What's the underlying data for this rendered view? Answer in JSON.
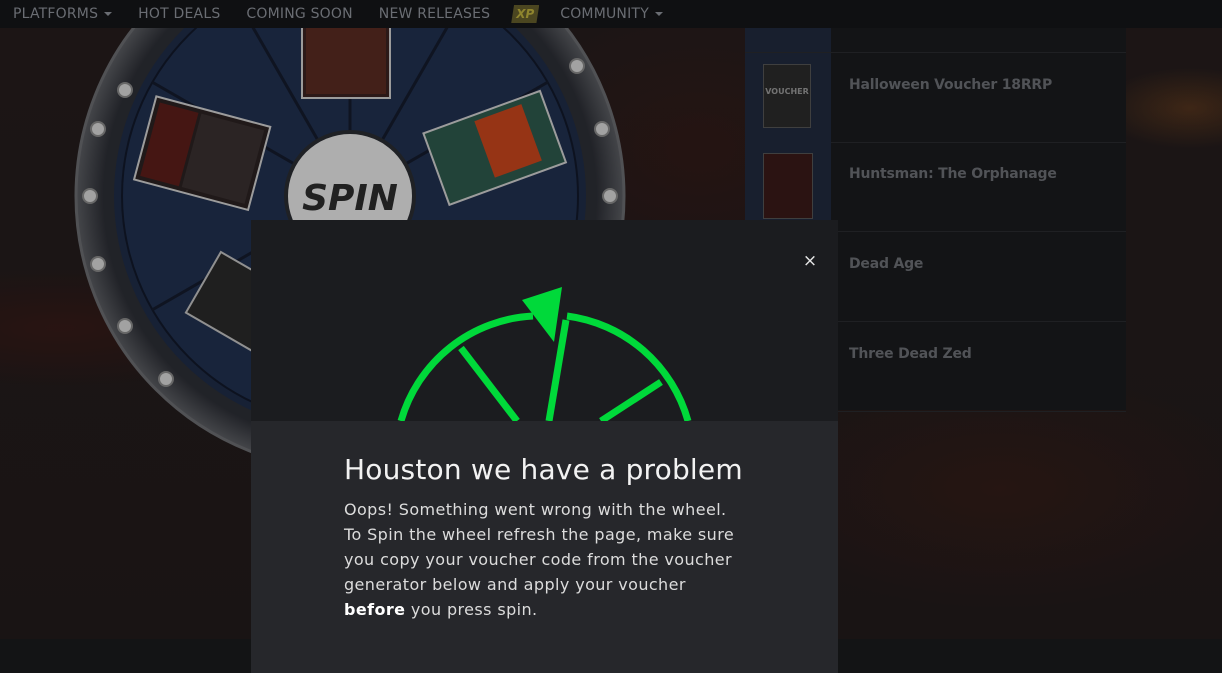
{
  "nav": {
    "items": [
      {
        "label": "PLATFORMS",
        "dropdown": true
      },
      {
        "label": "HOT DEALS",
        "dropdown": false
      },
      {
        "label": "COMING SOON",
        "dropdown": false
      },
      {
        "label": "NEW RELEASES",
        "dropdown": false
      },
      {
        "label": "XP",
        "badge": true
      },
      {
        "label": "COMMUNITY",
        "dropdown": true
      }
    ]
  },
  "wheel": {
    "center_label": "SPIN"
  },
  "deals": [
    {
      "title": ""
    },
    {
      "title": "Halloween Voucher 18RRP",
      "thumb_text": "VOUCHER"
    },
    {
      "title": "Huntsman: The Orphanage"
    },
    {
      "title": "Dead Age"
    },
    {
      "title": "Three Dead Zed"
    }
  ],
  "modal": {
    "close_icon": "×",
    "title": "Houston we have a problem",
    "line1": "Oops! Something went wrong with the wheel.",
    "line2_before": "To Spin the wheel refresh the page, make sure you copy your voucher code from the voucher generator below and apply your voucher ",
    "line2_bold": "before",
    "line2_after": " you press spin.",
    "accent_color": "#00d93a"
  }
}
